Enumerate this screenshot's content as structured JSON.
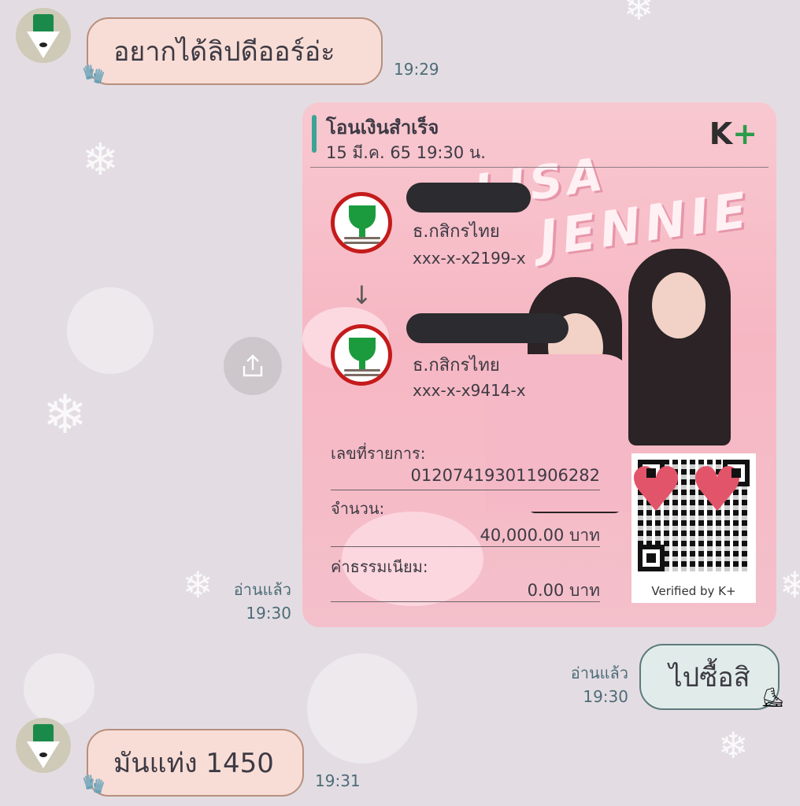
{
  "messages": [
    {
      "text": "อยากได้ลิปดีออร์อ่ะ",
      "time": "19:29",
      "side": "in"
    },
    {
      "type": "transfer_slip",
      "read_label": "อ่านแล้ว",
      "time": "19:30"
    },
    {
      "text": "ไปซื้อสิ",
      "read_label": "อ่านแล้ว",
      "time": "19:30",
      "side": "out"
    },
    {
      "text": "มันแท่ง 1450",
      "time": "19:31",
      "side": "in"
    }
  ],
  "slip": {
    "title": "โอนเงินสำเร็จ",
    "datetime": "15 มี.ค. 65  19:30 น.",
    "logo_k": "K",
    "logo_plus": "+",
    "bg_text_1": "LISA",
    "bg_text_2": "JENNIE",
    "from": {
      "bank": "ธ.กสิกรไทย",
      "account": "xxx-x-x2199-x"
    },
    "to": {
      "bank": "ธ.กสิกรไทย",
      "account": "xxx-x-x9414-x"
    },
    "ref_label": "เลขที่รายการ:",
    "ref_value": "012074193011906282",
    "amount_label": "จำนวน:",
    "amount_value": "40,000.00 บาท",
    "fee_label": "ค่าธรรมเนียม:",
    "fee_value": "0.00 บาท",
    "verified": "Verified by K+"
  },
  "colors": {
    "background": "#e3dde3",
    "incoming_bubble": "#f8ddd6",
    "outgoing_bubble": "#e1ecea",
    "time_text": "#4d6c77",
    "slip_pink": "#f6b7c3",
    "kbank_green": "#1c9b3e",
    "kbank_red": "#c51b1b"
  },
  "icons": [
    "share-icon",
    "down-arrow-icon",
    "heart-icon",
    "snowflake-icon",
    "mitten-icon",
    "skate-icon"
  ]
}
